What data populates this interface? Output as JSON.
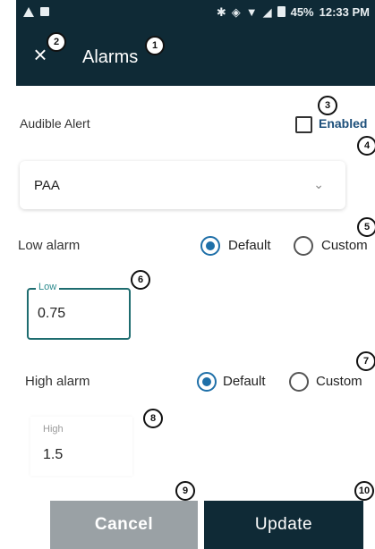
{
  "status_bar": {
    "battery": "45%",
    "time": "12:33 PM"
  },
  "app_bar": {
    "close_glyph": "×",
    "title": "Alarms"
  },
  "badges": [
    "1",
    "2",
    "3",
    "4",
    "5",
    "6",
    "7",
    "8",
    "9",
    "10"
  ],
  "audible_alert": {
    "label": "Audible Alert",
    "checkbox_label": "Enabled",
    "checked": false
  },
  "parameter_select": {
    "value": "PAA",
    "chevron": "⌄"
  },
  "low_alarm": {
    "label": "Low alarm",
    "option_default": "Default",
    "option_custom": "Custom",
    "selected": "Default",
    "field_label": "Low",
    "field_value": "0.75"
  },
  "high_alarm": {
    "label": "High alarm",
    "option_default": "Default",
    "option_custom": "Custom",
    "selected": "Default",
    "field_label": "High",
    "field_value": "1.5"
  },
  "buttons": {
    "cancel": "Cancel",
    "update": "Update"
  },
  "colors": {
    "app_bar": "#0f2a36",
    "accent": "#1e6fa8",
    "cancel_button": "#9aa1a5",
    "update_button": "#0f2a36",
    "enabled_label": "#1c4f7a"
  }
}
